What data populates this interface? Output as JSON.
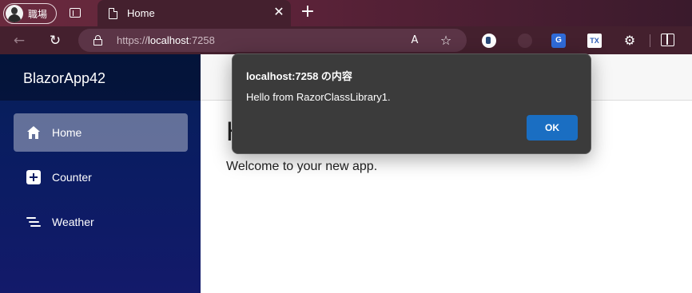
{
  "browser": {
    "profile": {
      "label": "職場"
    },
    "tab": {
      "title": "Home",
      "close_glyph": "✕"
    },
    "new_tab_glyph": "+",
    "address": {
      "scheme": "https://",
      "host": "localhost",
      "port": ":7258"
    },
    "icons": {
      "back": "←",
      "reload": "↻",
      "read_aloud": "A",
      "favorite": "☆",
      "translate": "G",
      "extension_tx": "TX",
      "extensions": "⚙"
    }
  },
  "app": {
    "brand": "BlazorApp42",
    "nav": [
      {
        "label": "Home",
        "icon": "home-icon",
        "active": true
      },
      {
        "label": "Counter",
        "icon": "plus-icon",
        "active": false
      },
      {
        "label": "Weather",
        "icon": "list-icon",
        "active": false
      }
    ],
    "page": {
      "heading": "H",
      "text": "Welcome to your new app."
    }
  },
  "dialog": {
    "title": "localhost:7258 の内容",
    "message": "Hello from RazorClassLibrary1.",
    "ok_label": "OK"
  },
  "colors": {
    "tabstrip": "#5a2238",
    "toolbar": "#44202e",
    "sidebar_top": "#062058",
    "sidebar_bottom": "#131a6a",
    "dialog_bg": "#3b3b3b",
    "ok_button": "#1a6ec2"
  }
}
